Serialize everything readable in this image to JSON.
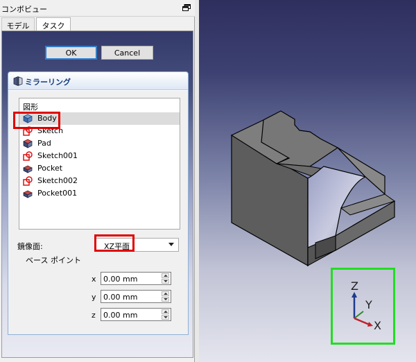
{
  "panel": {
    "title": "コンボビュー",
    "tabs": [
      "モデル",
      "タスク"
    ],
    "active_tab": "タスク"
  },
  "dialog": {
    "ok_label": "OK",
    "cancel_label": "Cancel"
  },
  "mirror": {
    "title": "ミラーリング",
    "shape_header": "図形",
    "items": [
      {
        "label": "Body",
        "icon": "body-icon"
      },
      {
        "label": "Sketch",
        "icon": "sketch-icon"
      },
      {
        "label": "Pad",
        "icon": "pad-icon"
      },
      {
        "label": "Sketch001",
        "icon": "sketch-icon"
      },
      {
        "label": "Pocket",
        "icon": "pocket-icon"
      },
      {
        "label": "Sketch002",
        "icon": "sketch-icon"
      },
      {
        "label": "Pocket001",
        "icon": "pocket-icon"
      }
    ],
    "selected_item": "Body",
    "mirror_plane_label": "鏡像面:",
    "mirror_plane_value": "XZ平面",
    "base_point_label": "ベース ポイント",
    "coords": [
      {
        "axis": "x",
        "value": "0.00 mm"
      },
      {
        "axis": "y",
        "value": "0.00 mm"
      },
      {
        "axis": "z",
        "value": "0.00 mm"
      }
    ]
  },
  "view": {
    "axis_labels": {
      "z": "Z",
      "y": "Y",
      "x": "X"
    }
  },
  "colors": {
    "highlight_red": "#e00000",
    "highlight_green": "#22dd22",
    "viewport_top": "#2f2f5e",
    "viewport_bottom": "#e4e5ee"
  }
}
